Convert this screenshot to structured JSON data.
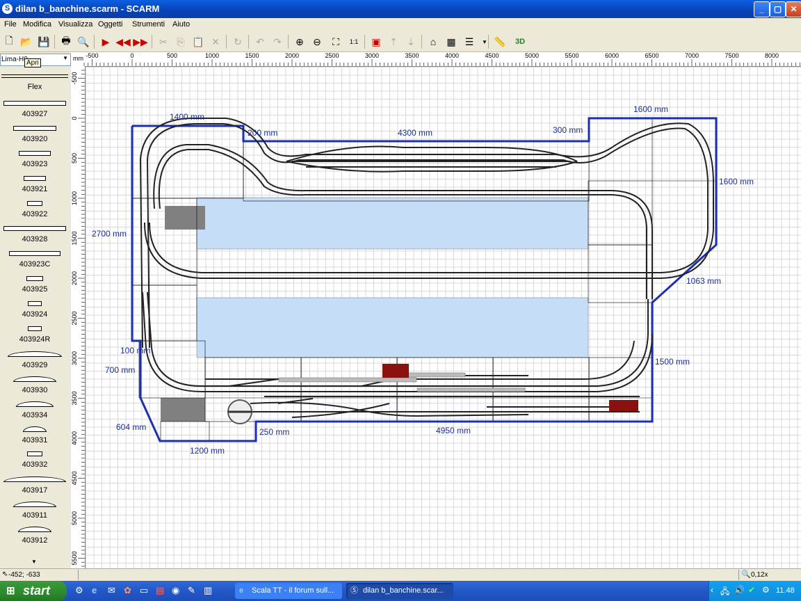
{
  "window": {
    "title": "dilan b_banchine.scarm - SCARM",
    "app_icon": "S"
  },
  "menu": [
    "File",
    "Modifica",
    "Visualizza",
    "Oggetti",
    "Strumenti",
    "Aiuto"
  ],
  "library": {
    "selected": "Lima-H0",
    "tooltip": "Apri",
    "flex_label": "Flex",
    "items": [
      "403927",
      "403920",
      "403923",
      "403921",
      "403922",
      "403928",
      "403923C",
      "403925",
      "403924",
      "403924R",
      "403929",
      "403930",
      "403934",
      "403931",
      "403932",
      "403917",
      "403911",
      "403912"
    ]
  },
  "units_label": "mm",
  "ruler_top": [
    "-500",
    "0",
    "500",
    "1000",
    "1500",
    "2000",
    "2500",
    "3000",
    "3500",
    "4000",
    "4500",
    "5000",
    "5500",
    "6000",
    "6500",
    "7000",
    "7500",
    "8000"
  ],
  "ruler_left": [
    "-500",
    "0",
    "500",
    "1000",
    "1500",
    "2000",
    "2500",
    "3000",
    "3500",
    "4000",
    "4500",
    "5000",
    "5500"
  ],
  "dimensions": {
    "d1400": "1400 mm",
    "d200": "200 mm",
    "d4300": "4300 mm",
    "d300": "300 mm",
    "d1600_top": "1600 mm",
    "d1600_right": "1600 mm",
    "d2700": "2700 mm",
    "d1063": "1063 mm",
    "d1500": "1500 mm",
    "d100": "100 mm",
    "d700": "700 mm",
    "d604": "604 mm",
    "d250": "250 mm",
    "d4950": "4950 mm",
    "d1200": "1200 mm"
  },
  "status": {
    "coords": "-452; -633",
    "zoom": "0,12x"
  },
  "taskbar": {
    "start": "start",
    "tasks": [
      "Scala TT - il forum sull...",
      "dilan b_banchine.scar..."
    ],
    "clock": "11.48"
  }
}
